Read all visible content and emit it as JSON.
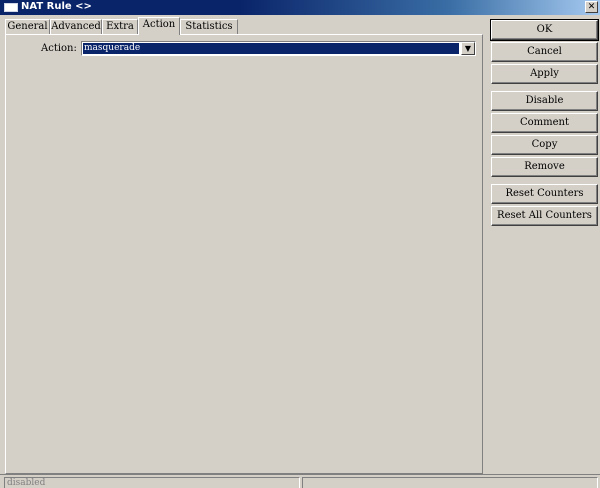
{
  "window": {
    "title": "NAT Rule <>",
    "close_glyph": "✕"
  },
  "tabs": [
    {
      "label": "General",
      "active": false
    },
    {
      "label": "Advanced",
      "active": false
    },
    {
      "label": "Extra",
      "active": false
    },
    {
      "label": "Action",
      "active": true
    },
    {
      "label": "Statistics",
      "active": false
    }
  ],
  "action_tab": {
    "action_label": "Action:",
    "action_value": "masquerade",
    "dropdown_icon": "chevron-down-icon"
  },
  "buttons": {
    "ok": "OK",
    "cancel": "Cancel",
    "apply": "Apply",
    "disable": "Disable",
    "comment": "Comment",
    "copy": "Copy",
    "remove": "Remove",
    "reset_counters": "Reset Counters",
    "reset_all_counters": "Reset All Counters"
  },
  "status": {
    "state": "disabled",
    "right": ""
  },
  "colors": {
    "titlebar": "#0a246a",
    "selection": "#0a246a",
    "window_bg": "#d4d0c8"
  }
}
